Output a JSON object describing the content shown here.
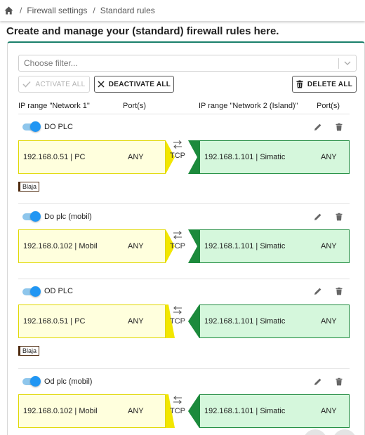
{
  "breadcrumb": {
    "items": [
      "Firewall settings",
      "Standard rules"
    ],
    "separator": "/"
  },
  "page": {
    "title": "Create and manage your (standard) firewall rules here."
  },
  "filter": {
    "placeholder": "Choose filter..."
  },
  "toolbar": {
    "activate_all": "ACTIVATE ALL",
    "deactivate_all": "DEACTIVATE ALL",
    "delete_all": "DELETE ALL"
  },
  "columns": {
    "ip_range_1": "IP range \"Network 1\"",
    "ports_1": "Port(s)",
    "ip_range_2": "IP range \"Network 2 (Island)\"",
    "ports_2": "Port(s)"
  },
  "colors": {
    "accent": "#1a7f6a",
    "toggle_on": "#2196f3",
    "network1_fill": "#ffffdd",
    "network1_border": "#e0d800",
    "network2_fill": "#d5f7dc",
    "network2_border": "#1c8a3c"
  },
  "rules": [
    {
      "name": "DO PLC",
      "enabled": true,
      "direction": "network1-to-network2",
      "left_ip": "192.168.0.51 | PC",
      "left_port": "ANY",
      "protocol": "TCP",
      "right_ip": "192.168.1.101 | Simatic",
      "right_port": "ANY",
      "tag": "Blaja"
    },
    {
      "name": "Do plc (mobil)",
      "enabled": true,
      "direction": "network1-to-network2",
      "left_ip": "192.168.0.102 | Mobil",
      "left_port": "ANY",
      "protocol": "TCP",
      "right_ip": "192.168.1.101 | Simatic",
      "right_port": "ANY",
      "tag": ""
    },
    {
      "name": "OD PLC",
      "enabled": true,
      "direction": "network2-to-network1",
      "left_ip": "192.168.0.51 | PC",
      "left_port": "ANY",
      "protocol": "TCP",
      "right_ip": "192.168.1.101 | Simatic",
      "right_port": "ANY",
      "tag": "Blaja"
    },
    {
      "name": "Od plc (mobil)",
      "enabled": true,
      "direction": "network2-to-network1",
      "left_ip": "192.168.0.102 | Mobil",
      "left_port": "ANY",
      "protocol": "TCP",
      "right_ip": "192.168.1.101 | Simatic",
      "right_port": "ANY",
      "tag": ""
    }
  ]
}
